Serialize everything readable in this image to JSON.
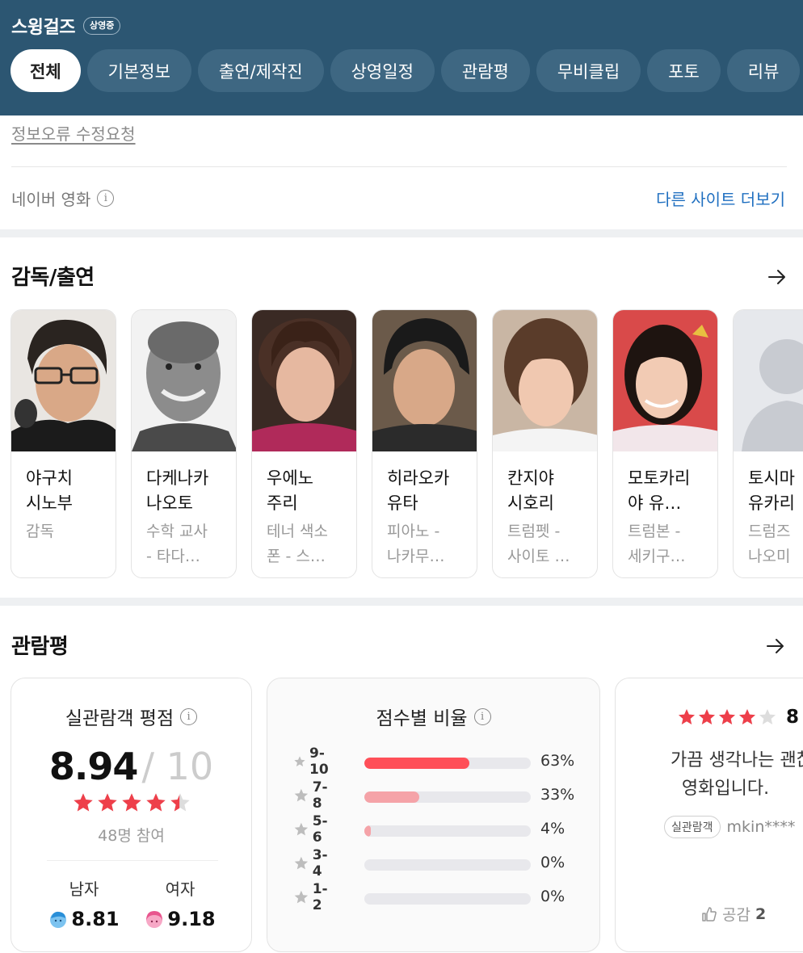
{
  "header": {
    "title": "스윙걸즈",
    "status": "상영중",
    "tabs": [
      "전체",
      "기본정보",
      "출연/제작진",
      "상영일정",
      "관람평",
      "무비클립",
      "포토",
      "리뷰"
    ]
  },
  "info": {
    "report_link": "정보오류 수정요청",
    "source_label": "네이버 영화",
    "more_sites": "다른 사이트 더보기"
  },
  "cast": {
    "title": "감독/출연",
    "members": [
      {
        "name": "야구치\n시노부",
        "role": "감독"
      },
      {
        "name": "다케나카\n나오토",
        "role": "수학 교사\n- 타다…"
      },
      {
        "name": "우에노\n주리",
        "role": "테너 색소\n폰 - 스…"
      },
      {
        "name": "히라오카\n유타",
        "role": "피아노 -\n나카무…"
      },
      {
        "name": "칸지야\n시호리",
        "role": "트럼펫 -\n사이토 …"
      },
      {
        "name": "모토카리\n야 유…",
        "role": "트럼본 -\n세키구…"
      },
      {
        "name": "토시마\n유카리",
        "role": "드럼즈\n나오미"
      }
    ]
  },
  "reviews": {
    "title": "관람평",
    "rating_card": {
      "title": "실관람객 평점",
      "score": "8.94",
      "max": "/ 10",
      "rating_fraction": 0.894,
      "participants": "48명 참여",
      "male_label": "남자",
      "male_score": "8.81",
      "female_label": "여자",
      "female_score": "9.18"
    },
    "distribution": {
      "title": "점수별 비율",
      "rows": [
        {
          "label": "9-10",
          "percent": "63%",
          "value": 63,
          "color": "#ff4f58"
        },
        {
          "label": "7-8",
          "percent": "33%",
          "value": 33,
          "color": "#f5a3a8"
        },
        {
          "label": "5-6",
          "percent": "4%",
          "value": 4,
          "color": "#f5a3a8"
        },
        {
          "label": "3-4",
          "percent": "0%",
          "value": 0,
          "color": "#f5a3a8"
        },
        {
          "label": "1-2",
          "percent": "0%",
          "value": 0,
          "color": "#f5a3a8"
        }
      ]
    },
    "review_card": {
      "score": "8",
      "stars_filled": 4,
      "text_line1": "가끔 생각나는 괜찮",
      "text_line2": "영화입니다.",
      "badge": "실관람객",
      "reviewer": "mkin****",
      "like_label": "공감",
      "like_count": "2"
    }
  },
  "colors": {
    "header_bg": "#2c5672",
    "star_red": "#ee3f4a",
    "link_blue": "#1f6fc0"
  }
}
